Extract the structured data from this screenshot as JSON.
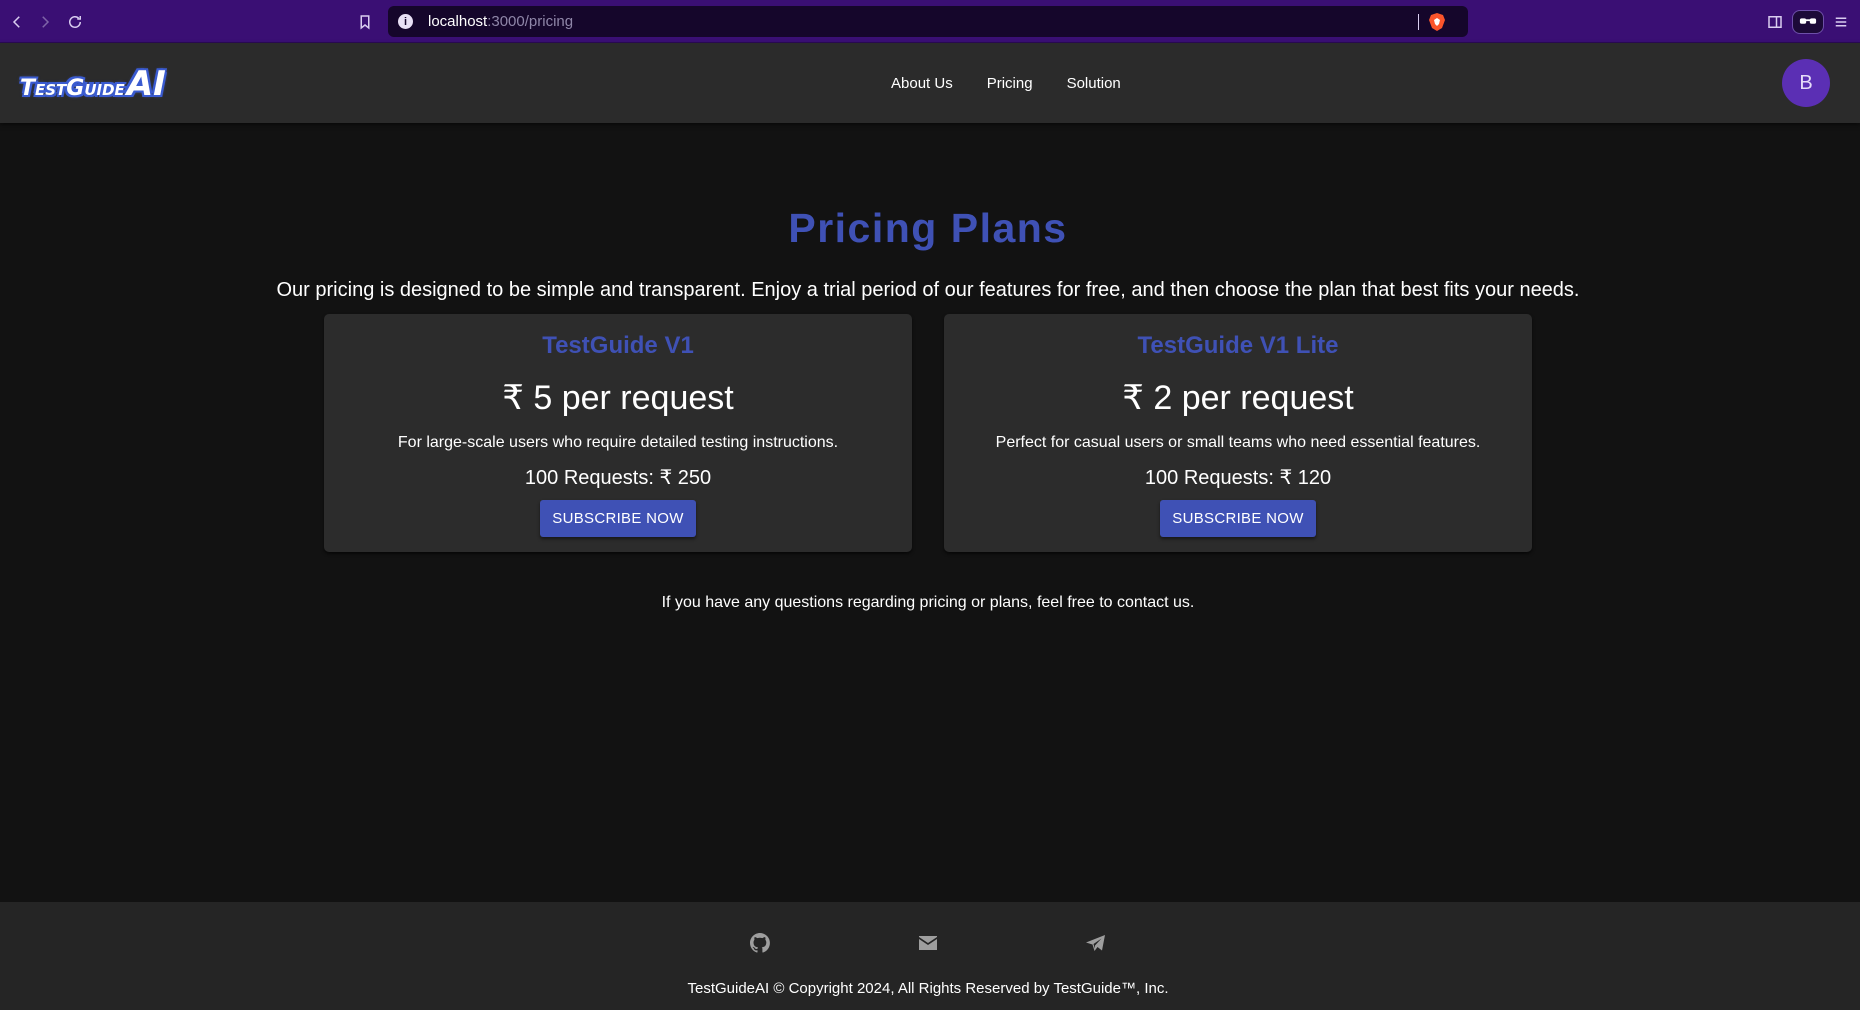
{
  "browser": {
    "url_host": "localhost",
    "url_path": ":3000/pricing",
    "icons": [
      "back-icon",
      "forward-icon",
      "reload-icon",
      "bookmark-icon",
      "site-info-icon",
      "brave-shield-icon",
      "sidebar-icon",
      "wallet-icon",
      "menu-icon"
    ]
  },
  "header": {
    "logo_prefix": "TestGuide",
    "logo_suffix": "AI",
    "nav": [
      {
        "label": "About Us"
      },
      {
        "label": "Pricing"
      },
      {
        "label": "Solution"
      }
    ],
    "avatar_initial": "B"
  },
  "main": {
    "title": "Pricing Plans",
    "intro": "Our pricing is designed to be simple and transparent. Enjoy a trial period of our features for free, and then choose the plan that best fits your needs.",
    "plans": [
      {
        "name": "TestGuide V1",
        "price": "₹ 5 per request",
        "description": "For large-scale users who require detailed testing instructions.",
        "bundle": "100 Requests: ₹ 250",
        "button": "SUBSCRIBE NOW"
      },
      {
        "name": "TestGuide V1 Lite",
        "price": "₹ 2 per request",
        "description": "Perfect for casual users or small teams who need essential features.",
        "bundle": "100 Requests: ₹ 120",
        "button": "SUBSCRIBE NOW"
      }
    ],
    "contact_note": "If you have any questions regarding pricing or plans, feel free to contact us."
  },
  "footer": {
    "icons": [
      "github-icon",
      "mail-icon",
      "telegram-icon"
    ],
    "copyright": "TestGuideAI © Copyright 2024, All Rights Reserved by TestGuide™, Inc."
  },
  "colors": {
    "accent": "#3f51b5",
    "background": "#121212",
    "card": "#2c2c2c",
    "header": "#2b2b2b",
    "browser_bar": "#3a0f74",
    "avatar": "#5b2fb4"
  }
}
